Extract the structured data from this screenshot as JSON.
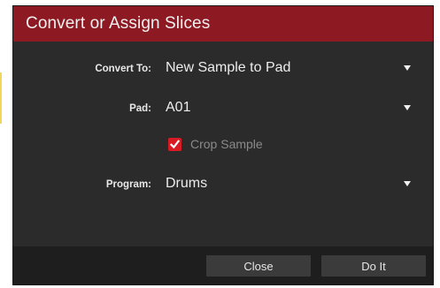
{
  "dialog": {
    "title": "Convert or Assign Slices",
    "title_color": "#8d1a22",
    "background_color": "#2b2b2b"
  },
  "fields": {
    "convert_to": {
      "label": "Convert To:",
      "value": "New Sample to Pad"
    },
    "pad": {
      "label": "Pad:",
      "value": "A01"
    },
    "program": {
      "label": "Program:",
      "value": "Drums"
    }
  },
  "crop_sample": {
    "label": "Crop Sample",
    "checked": true,
    "check_color": "#d81b22"
  },
  "footer": {
    "close_label": "Close",
    "do_it_label": "Do It"
  }
}
